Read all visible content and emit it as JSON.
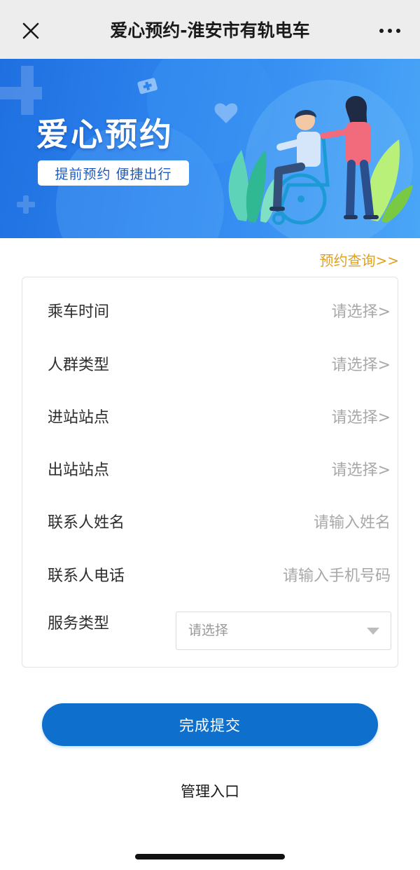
{
  "navbar": {
    "close_icon": "close-icon",
    "title": "爱心预约-淮安市有轨电车",
    "more_icon": "more-dots-icon"
  },
  "banner": {
    "title": "爱心预约",
    "tagline": "提前预约  便捷出行",
    "accent_color": "#2f86f0"
  },
  "query_link": "预约查询>>",
  "form": {
    "rows": [
      {
        "label": "乘车时间",
        "value": "请选择>"
      },
      {
        "label": "人群类型",
        "value": "请选择>"
      },
      {
        "label": "进站站点",
        "value": "请选择>"
      },
      {
        "label": "出站站点",
        "value": "请选择>"
      },
      {
        "label": "联系人姓名",
        "placeholder": "请输入姓名"
      },
      {
        "label": "联系人电话",
        "placeholder": "请输入手机号码"
      }
    ],
    "service": {
      "label": "服务类型",
      "selected": "请选择"
    }
  },
  "submit_label": "完成提交",
  "admin_label": "管理入口",
  "colors": {
    "primary": "#0f6fcd",
    "link": "#e0a11b",
    "placeholder": "#a8a8a8"
  }
}
